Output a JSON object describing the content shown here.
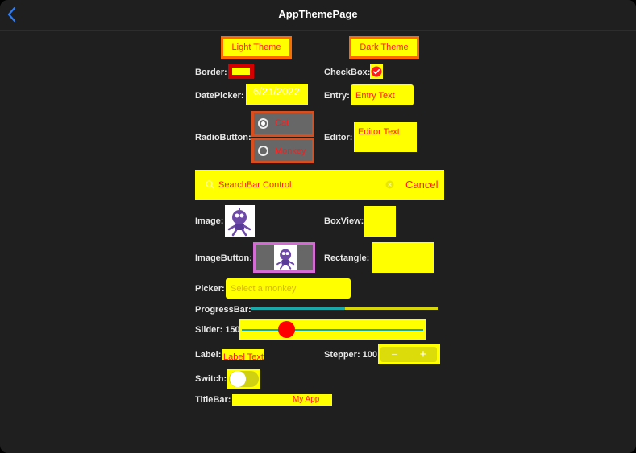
{
  "nav": {
    "title": "AppThemePage"
  },
  "buttons": {
    "light": "Light Theme",
    "dark": "Dark Theme"
  },
  "labels": {
    "border": "Border:",
    "checkbox": "CheckBox:",
    "datepicker": "DatePicker:",
    "entry": "Entry:",
    "radiobutton": "RadioButton:",
    "editor": "Editor:",
    "image": "Image:",
    "boxview": "BoxView:",
    "imagebutton": "ImageButton:",
    "rectangle": "Rectangle:",
    "picker": "Picker:",
    "progressbar": "ProgressBar:",
    "slider": "Slider: 150",
    "label": "Label:",
    "stepper": "Stepper: 100",
    "switch": "Switch:",
    "titlebar": "TitleBar:"
  },
  "datepicker": {
    "value": "6/21/2022"
  },
  "entry": {
    "value": "Entry Text"
  },
  "editor": {
    "value": "Editor Text"
  },
  "radio": [
    {
      "label": "Cat",
      "selected": true
    },
    {
      "label": "Monkey",
      "selected": false
    }
  ],
  "searchbar": {
    "placeholder": "SearchBar Control",
    "cancel": "Cancel"
  },
  "picker": {
    "placeholder": "Select a monkey"
  },
  "progress": {
    "value": 0.5
  },
  "slider": {
    "value": 150,
    "fraction": 0.22
  },
  "label_control": {
    "text": "Label Text"
  },
  "stepper": {
    "minus": "−",
    "plus": "+"
  },
  "switch": {
    "on": true
  },
  "titlebar": {
    "text": "My App"
  },
  "colors": {
    "accent_yellow": "#ffff00",
    "text_red": "#ff1a1a",
    "border_orange": "#ff6a00",
    "progress_teal": "#1aa8a8",
    "slider_thumb": "#ff0000",
    "imagebutton_border": "#d46ad4"
  }
}
